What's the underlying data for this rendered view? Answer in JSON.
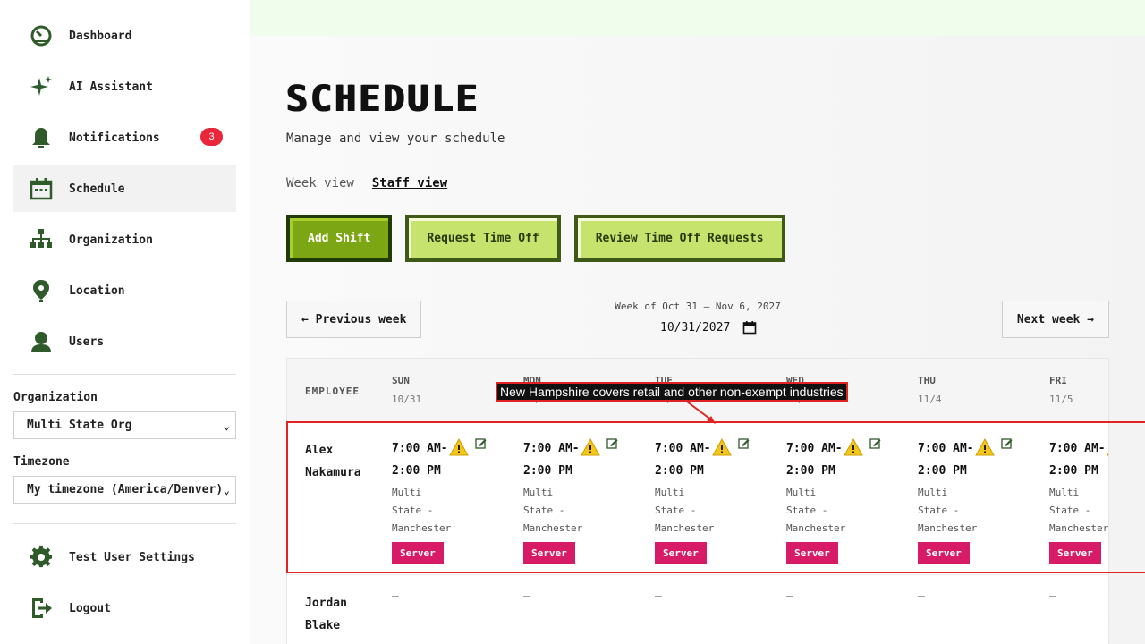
{
  "sidebar": {
    "items": [
      {
        "label": "Dashboard",
        "icon": "dashboard-icon"
      },
      {
        "label": "AI Assistant",
        "icon": "sparkle-icon"
      },
      {
        "label": "Notifications",
        "icon": "bell-icon",
        "badge": "3"
      },
      {
        "label": "Schedule",
        "icon": "calendar-icon",
        "active": true
      },
      {
        "label": "Organization",
        "icon": "org-chart-icon"
      },
      {
        "label": "Location",
        "icon": "location-pin-icon"
      },
      {
        "label": "Users",
        "icon": "user-icon"
      }
    ],
    "organization_label": "Organization",
    "organization_value": "Multi State Org",
    "timezone_label": "Timezone",
    "timezone_value": "My timezone (America/Denver)",
    "bottom_items": [
      {
        "label": "Test User Settings",
        "icon": "gear-icon"
      },
      {
        "label": "Logout",
        "icon": "logout-icon"
      }
    ]
  },
  "page": {
    "title": "SCHEDULE",
    "subtitle": "Manage and view your schedule",
    "views": [
      "Week view",
      "Staff view"
    ],
    "active_view": "Staff view"
  },
  "actions": {
    "add_shift": "Add Shift",
    "request_time_off": "Request Time Off",
    "review_time_off": "Review Time Off Requests"
  },
  "week_nav": {
    "prev": "← Previous week",
    "next": "Next week →",
    "label": "Week of Oct 31 – Nov 6, 2027",
    "date_value": "10/31/2027"
  },
  "schedule": {
    "employee_header": "EMPLOYEE",
    "days": [
      {
        "day": "SUN",
        "date": "10/31"
      },
      {
        "day": "MON",
        "date": "11/1"
      },
      {
        "day": "TUE",
        "date": "11/2"
      },
      {
        "day": "WED",
        "date": "11/3"
      },
      {
        "day": "THU",
        "date": "11/4"
      },
      {
        "day": "FRI",
        "date": "11/5"
      }
    ],
    "rows": [
      {
        "employee_first": "Alex",
        "employee_last": "Nakamura",
        "shift_start": "7:00 AM-",
        "shift_end": "2:00 PM",
        "location_1": "Multi",
        "location_2": "State -",
        "location_3": "Manchester",
        "role": "Server"
      },
      {
        "employee_first": "Jordan",
        "employee_last": "Blake",
        "empty": "–"
      }
    ]
  },
  "tooltip": "New Hampshire covers retail and other non-exempt industries",
  "colors": {
    "primary_button": "#7da614",
    "secondary_button": "#c5e36d",
    "role_badge": "#d81b66",
    "notification_badge": "#e8283a",
    "highlight": "#e02424"
  }
}
